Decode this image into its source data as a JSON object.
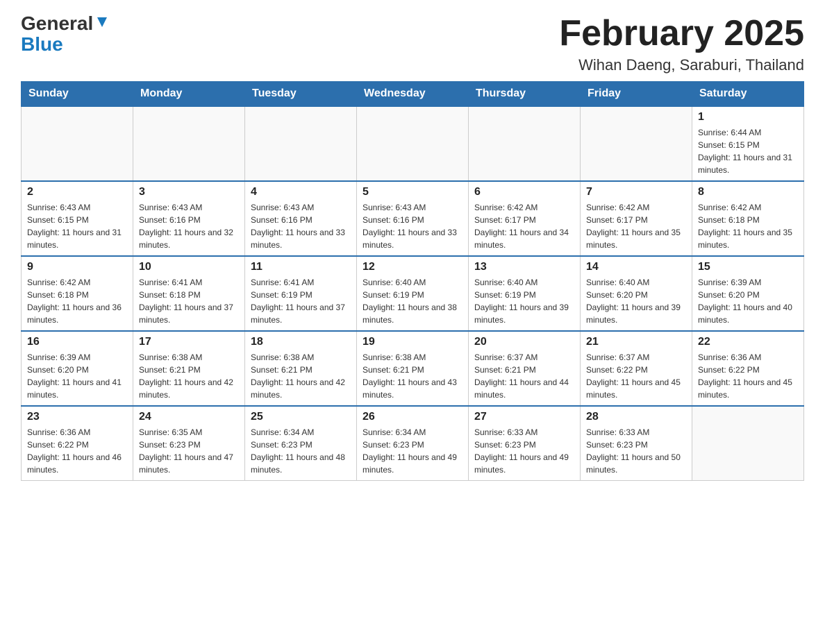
{
  "logo": {
    "part1": "General",
    "part2": "Blue"
  },
  "title": "February 2025",
  "subtitle": "Wihan Daeng, Saraburi, Thailand",
  "weekdays": [
    "Sunday",
    "Monday",
    "Tuesday",
    "Wednesday",
    "Thursday",
    "Friday",
    "Saturday"
  ],
  "weeks": [
    [
      {
        "day": "",
        "info": ""
      },
      {
        "day": "",
        "info": ""
      },
      {
        "day": "",
        "info": ""
      },
      {
        "day": "",
        "info": ""
      },
      {
        "day": "",
        "info": ""
      },
      {
        "day": "",
        "info": ""
      },
      {
        "day": "1",
        "info": "Sunrise: 6:44 AM\nSunset: 6:15 PM\nDaylight: 11 hours and 31 minutes."
      }
    ],
    [
      {
        "day": "2",
        "info": "Sunrise: 6:43 AM\nSunset: 6:15 PM\nDaylight: 11 hours and 31 minutes."
      },
      {
        "day": "3",
        "info": "Sunrise: 6:43 AM\nSunset: 6:16 PM\nDaylight: 11 hours and 32 minutes."
      },
      {
        "day": "4",
        "info": "Sunrise: 6:43 AM\nSunset: 6:16 PM\nDaylight: 11 hours and 33 minutes."
      },
      {
        "day": "5",
        "info": "Sunrise: 6:43 AM\nSunset: 6:16 PM\nDaylight: 11 hours and 33 minutes."
      },
      {
        "day": "6",
        "info": "Sunrise: 6:42 AM\nSunset: 6:17 PM\nDaylight: 11 hours and 34 minutes."
      },
      {
        "day": "7",
        "info": "Sunrise: 6:42 AM\nSunset: 6:17 PM\nDaylight: 11 hours and 35 minutes."
      },
      {
        "day": "8",
        "info": "Sunrise: 6:42 AM\nSunset: 6:18 PM\nDaylight: 11 hours and 35 minutes."
      }
    ],
    [
      {
        "day": "9",
        "info": "Sunrise: 6:42 AM\nSunset: 6:18 PM\nDaylight: 11 hours and 36 minutes."
      },
      {
        "day": "10",
        "info": "Sunrise: 6:41 AM\nSunset: 6:18 PM\nDaylight: 11 hours and 37 minutes."
      },
      {
        "day": "11",
        "info": "Sunrise: 6:41 AM\nSunset: 6:19 PM\nDaylight: 11 hours and 37 minutes."
      },
      {
        "day": "12",
        "info": "Sunrise: 6:40 AM\nSunset: 6:19 PM\nDaylight: 11 hours and 38 minutes."
      },
      {
        "day": "13",
        "info": "Sunrise: 6:40 AM\nSunset: 6:19 PM\nDaylight: 11 hours and 39 minutes."
      },
      {
        "day": "14",
        "info": "Sunrise: 6:40 AM\nSunset: 6:20 PM\nDaylight: 11 hours and 39 minutes."
      },
      {
        "day": "15",
        "info": "Sunrise: 6:39 AM\nSunset: 6:20 PM\nDaylight: 11 hours and 40 minutes."
      }
    ],
    [
      {
        "day": "16",
        "info": "Sunrise: 6:39 AM\nSunset: 6:20 PM\nDaylight: 11 hours and 41 minutes."
      },
      {
        "day": "17",
        "info": "Sunrise: 6:38 AM\nSunset: 6:21 PM\nDaylight: 11 hours and 42 minutes."
      },
      {
        "day": "18",
        "info": "Sunrise: 6:38 AM\nSunset: 6:21 PM\nDaylight: 11 hours and 42 minutes."
      },
      {
        "day": "19",
        "info": "Sunrise: 6:38 AM\nSunset: 6:21 PM\nDaylight: 11 hours and 43 minutes."
      },
      {
        "day": "20",
        "info": "Sunrise: 6:37 AM\nSunset: 6:21 PM\nDaylight: 11 hours and 44 minutes."
      },
      {
        "day": "21",
        "info": "Sunrise: 6:37 AM\nSunset: 6:22 PM\nDaylight: 11 hours and 45 minutes."
      },
      {
        "day": "22",
        "info": "Sunrise: 6:36 AM\nSunset: 6:22 PM\nDaylight: 11 hours and 45 minutes."
      }
    ],
    [
      {
        "day": "23",
        "info": "Sunrise: 6:36 AM\nSunset: 6:22 PM\nDaylight: 11 hours and 46 minutes."
      },
      {
        "day": "24",
        "info": "Sunrise: 6:35 AM\nSunset: 6:23 PM\nDaylight: 11 hours and 47 minutes."
      },
      {
        "day": "25",
        "info": "Sunrise: 6:34 AM\nSunset: 6:23 PM\nDaylight: 11 hours and 48 minutes."
      },
      {
        "day": "26",
        "info": "Sunrise: 6:34 AM\nSunset: 6:23 PM\nDaylight: 11 hours and 49 minutes."
      },
      {
        "day": "27",
        "info": "Sunrise: 6:33 AM\nSunset: 6:23 PM\nDaylight: 11 hours and 49 minutes."
      },
      {
        "day": "28",
        "info": "Sunrise: 6:33 AM\nSunset: 6:23 PM\nDaylight: 11 hours and 50 minutes."
      },
      {
        "day": "",
        "info": ""
      }
    ]
  ]
}
